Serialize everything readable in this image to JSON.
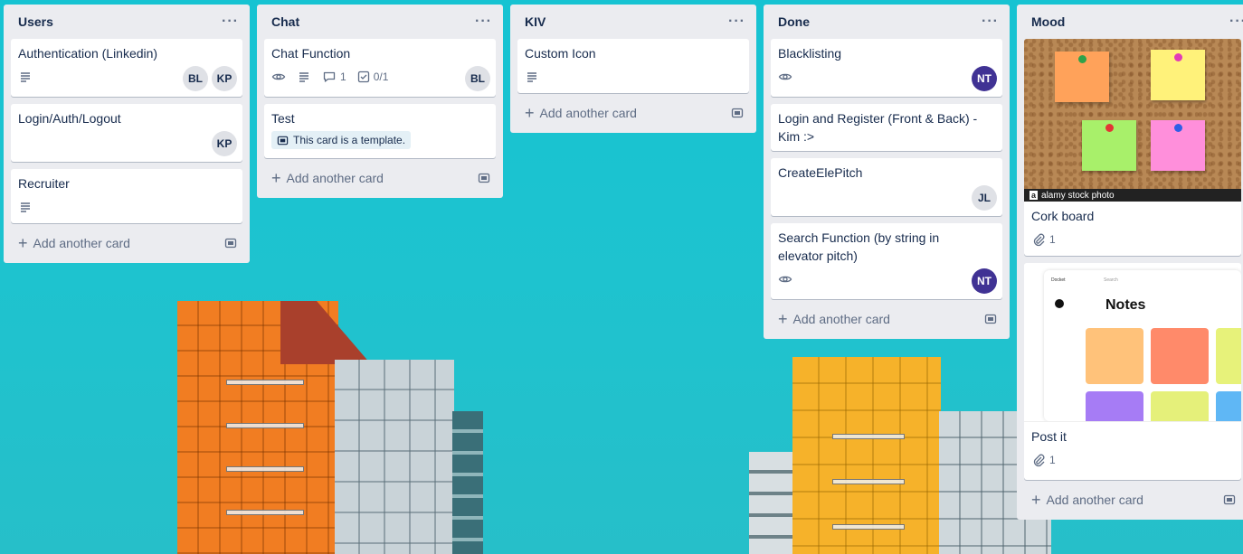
{
  "lists": [
    {
      "title": "Users",
      "menu": "···",
      "cards": [
        {
          "title": "Authentication (Linkedin)",
          "members": [
            "BL",
            "KP"
          ]
        },
        {
          "title": "Login/Auth/Logout",
          "members": [
            "KP"
          ]
        },
        {
          "title": "Recruiter"
        }
      ],
      "add_label": "Add another card"
    },
    {
      "title": "Chat",
      "menu": "···",
      "cards": [
        {
          "title": "Chat Function",
          "comments": "1",
          "checklist": "0/1",
          "members": [
            "BL"
          ]
        },
        {
          "title": "Test",
          "template_label": "This card is a template."
        }
      ],
      "add_label": "Add another card"
    },
    {
      "title": "KIV",
      "menu": "···",
      "cards": [
        {
          "title": "Custom Icon"
        }
      ],
      "add_label": "Add another card"
    },
    {
      "title": "Done",
      "menu": "···",
      "cards": [
        {
          "title": "Blacklisting",
          "members": [
            "NT"
          ]
        },
        {
          "title": "Login and Register (Front & Back) - Kim :>"
        },
        {
          "title": "CreateElePitch",
          "members": [
            "JL"
          ]
        },
        {
          "title": "Search Function (by string in elevator pitch)",
          "members": [
            "NT"
          ]
        }
      ],
      "add_label": "Add another card"
    },
    {
      "title": "Mood",
      "menu": "···",
      "cards": [
        {
          "title": "Cork board",
          "attachments": "1",
          "cover_caption": "alamy stock photo",
          "cover_logo": "a"
        },
        {
          "title": "Post it",
          "attachments": "1",
          "cover_app_title": "Notes",
          "cover_app_brand": "Docket",
          "cover_search": "Search"
        }
      ],
      "add_label": "Add another card"
    }
  ],
  "colors": {
    "background": "#1fc1cf",
    "list_bg": "#ebecf0",
    "avatar_purple": "#403294",
    "avatar_grey": "#dfe1e6"
  }
}
